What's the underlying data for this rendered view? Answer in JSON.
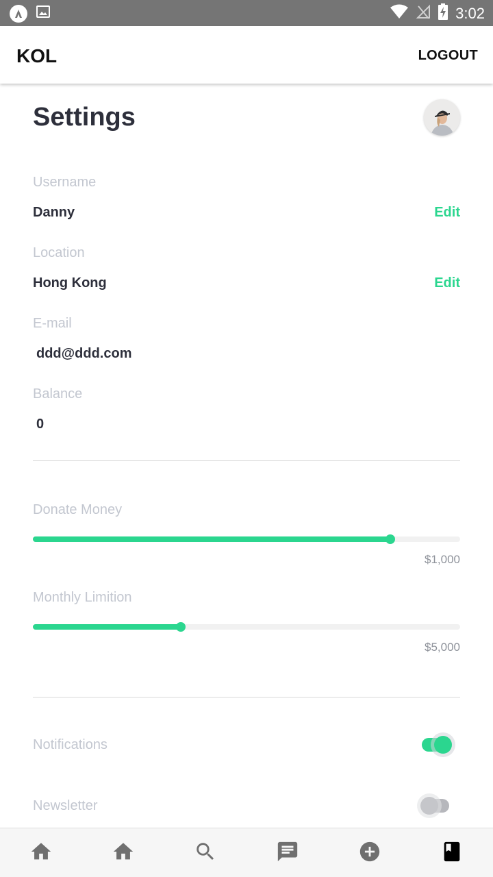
{
  "status_bar": {
    "time": "3:02",
    "icons": [
      "app-logo-icon",
      "image-icon",
      "wifi-icon",
      "no-signal-icon",
      "battery-charging-icon"
    ]
  },
  "app_bar": {
    "title": "KOL",
    "logout_label": "LOGOUT"
  },
  "settings": {
    "title": "Settings",
    "avatar": "user-avatar",
    "fields": [
      {
        "label": "Username",
        "value": "Danny",
        "edit_label": "Edit"
      },
      {
        "label": "Location",
        "value": "Hong Kong",
        "edit_label": "Edit"
      },
      {
        "label": "E-mail",
        "value": "ddd@ddd.com"
      },
      {
        "label": "Balance",
        "value": "0"
      }
    ],
    "sliders": [
      {
        "label": "Donate Money",
        "value_text": "$1,000",
        "fill_fraction": 0.836
      },
      {
        "label": "Monthly Limition",
        "value_text": "$5,000",
        "fill_fraction": 0.346
      }
    ],
    "toggles": [
      {
        "label": "Notifications",
        "on": true
      },
      {
        "label": "Newsletter",
        "on": false
      }
    ]
  },
  "colors": {
    "accent": "#2bd68f",
    "title_text": "#2d2f3b",
    "label_text": "#c3c7d0",
    "status_bar": "#757575",
    "nav_icon": "#6f6f6f",
    "nav_icon_active": "#000000"
  },
  "bottom_nav": [
    {
      "icon": "home-icon",
      "active": false
    },
    {
      "icon": "home-icon",
      "active": false
    },
    {
      "icon": "search-icon",
      "active": false
    },
    {
      "icon": "message-icon",
      "active": false
    },
    {
      "icon": "add-circle-icon",
      "active": false
    },
    {
      "icon": "bookmark-book-icon",
      "active": true
    }
  ]
}
